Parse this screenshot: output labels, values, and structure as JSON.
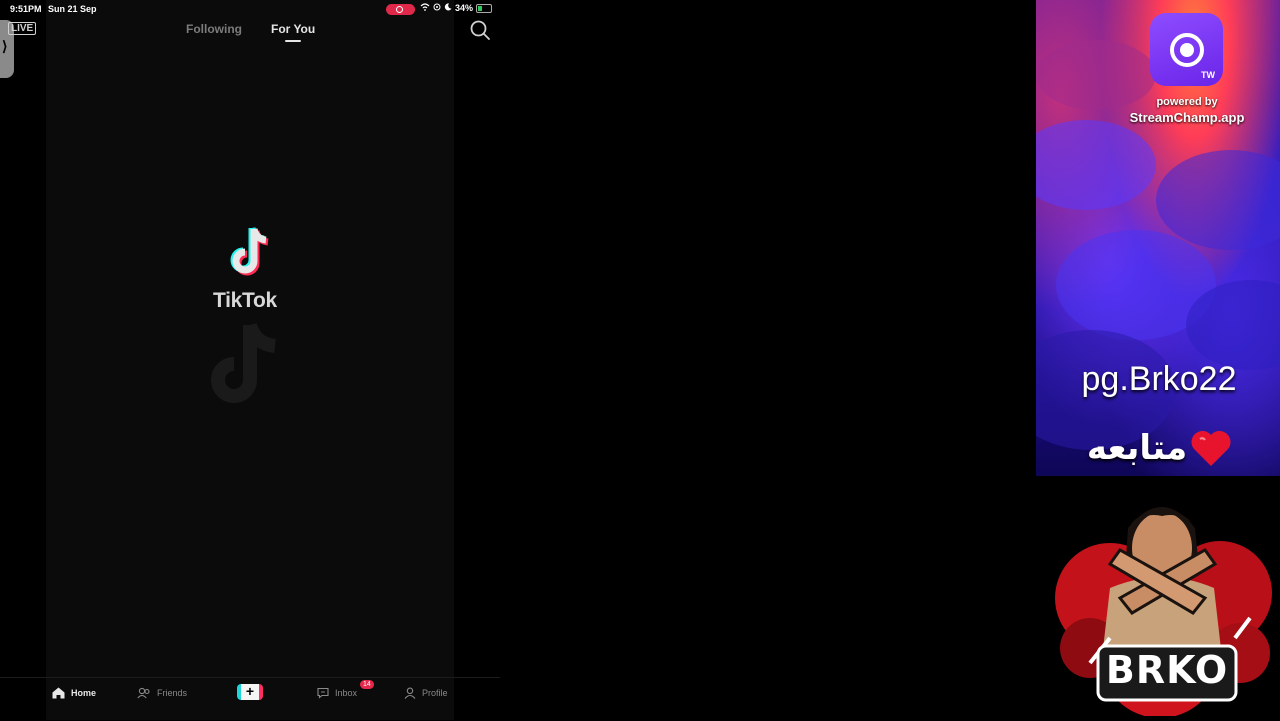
{
  "status_bar": {
    "time": "9:51PM",
    "date": "Sun 21 Sep",
    "battery": "34%"
  },
  "header": {
    "live_label": "LIVE",
    "tabs": [
      "Following",
      "For You"
    ],
    "active_tab": "For You"
  },
  "splash": {
    "wordmark": "TikTok"
  },
  "bottom_nav": {
    "home": "Home",
    "friends": "Friends",
    "create": "+",
    "inbox": "Inbox",
    "inbox_badge": "14",
    "profile": "Profile"
  },
  "overlay": {
    "app_badge": "TW",
    "powered_by": "powered by",
    "app_name": "StreamChamp.app",
    "username": "pg.Brko22",
    "follow_text": "متابعه",
    "logo_text": "BRKO"
  },
  "colors": {
    "record": "#e0284a",
    "badge": "#e6284d",
    "overlay_purple": "#2d1bb8",
    "heart": "#e8142e"
  }
}
